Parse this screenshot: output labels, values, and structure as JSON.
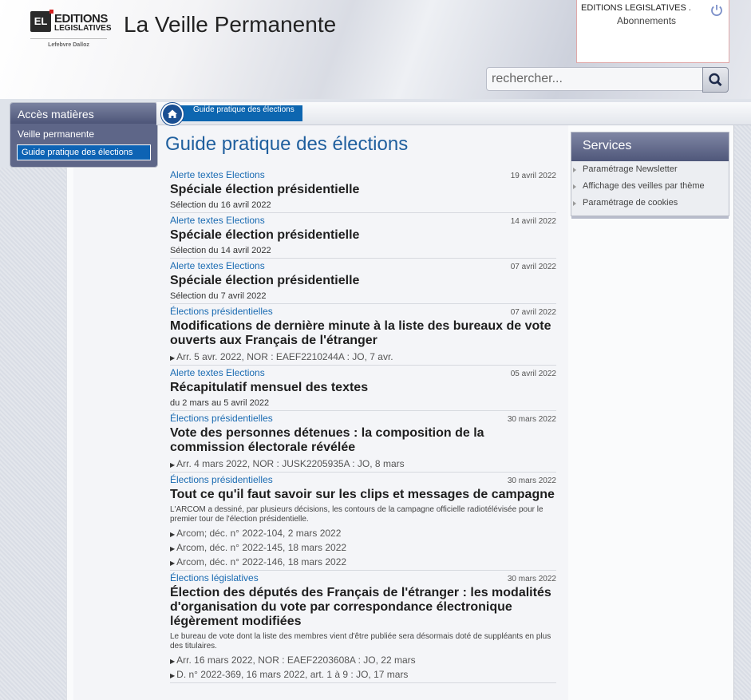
{
  "header": {
    "logo_mark": "EL",
    "logo_line1": "EDITIONS",
    "logo_line2": "LEGISLATIVES",
    "logo_line3": "Lefebvre Dalloz",
    "app_title": "La Veille Permanente"
  },
  "account": {
    "org": "EDITIONS LEGISLATIVES .",
    "subscriptions": "Abonnements",
    "power_icon": "power-icon"
  },
  "search": {
    "placeholder": "rechercher..."
  },
  "sidebar": {
    "title": "Accès matières",
    "items": [
      {
        "label": "Veille permanente"
      },
      {
        "label": "Guide pratique des élections"
      }
    ]
  },
  "breadcrumb": {
    "label": "Guide pratique des élections"
  },
  "page_title": "Guide pratique des élections",
  "articles": [
    {
      "category": "Alerte textes Elections",
      "date": "19 avril 2022",
      "title": "Spéciale élection présidentielle",
      "sub": "Sélection du 16 avril 2022"
    },
    {
      "category": "Alerte textes Elections",
      "date": "14 avril 2022",
      "title": "Spéciale élection présidentielle",
      "sub": "Sélection du 14 avril 2022"
    },
    {
      "category": "Alerte textes Elections",
      "date": "07 avril 2022",
      "title": "Spéciale élection présidentielle",
      "sub": "Sélection du 7 avril 2022"
    },
    {
      "category": "Élections présidentielles",
      "date": "07 avril 2022",
      "title": "Modifications de dernière minute à la liste des bureaux de vote ouverts aux Français de l'étranger",
      "refs": [
        "Arr. 5 avr. 2022, NOR : EAEF2210244A : JO, 7 avr."
      ]
    },
    {
      "category": "Alerte textes Elections",
      "date": "05 avril 2022",
      "title": "Récapitulatif mensuel des textes",
      "sub": "du 2 mars au 5 avril 2022"
    },
    {
      "category": "Élections présidentielles",
      "date": "30 mars 2022",
      "title": "Vote des personnes détenues : la composition de la commission électorale révélée",
      "refs": [
        "Arr. 4 mars 2022, NOR : JUSK2205935A : JO, 8 mars"
      ]
    },
    {
      "category": "Élections présidentielles",
      "date": "30 mars 2022",
      "title": "Tout ce qu'il faut savoir sur les clips et messages de campagne",
      "desc": "L'ARCOM a dessiné, par plusieurs décisions, les contours de la campagne officielle radiotélévisée pour le premier tour de l'élection présidentielle.",
      "refs": [
        "Arcom; déc. n° 2022-104, 2 mars 2022",
        "Arcom, déc. n° 2022-145, 18 mars 2022",
        "Arcom, déc. n° 2022-146, 18 mars 2022"
      ]
    },
    {
      "category": "Élections législatives",
      "date": "30 mars 2022",
      "title": "Élection des députés des Français de l'étranger : les modalités d'organisation du vote par correspondance électronique légèrement modifiées",
      "desc": "Le bureau de vote dont la liste des membres vient d'être publiée sera désormais doté de suppléants en plus des titulaires.",
      "refs": [
        "Arr. 16 mars 2022, NOR : EAEF2203608A : JO, 22 mars",
        "D. n° 2022-369, 16 mars 2022, art. 1 à 9 : JO, 17 mars"
      ]
    }
  ],
  "services": {
    "title": "Services",
    "items": [
      {
        "label": "Paramétrage Newsletter"
      },
      {
        "label": "Affichage des veilles par thème"
      },
      {
        "label": "Paramétrage de cookies"
      }
    ]
  }
}
